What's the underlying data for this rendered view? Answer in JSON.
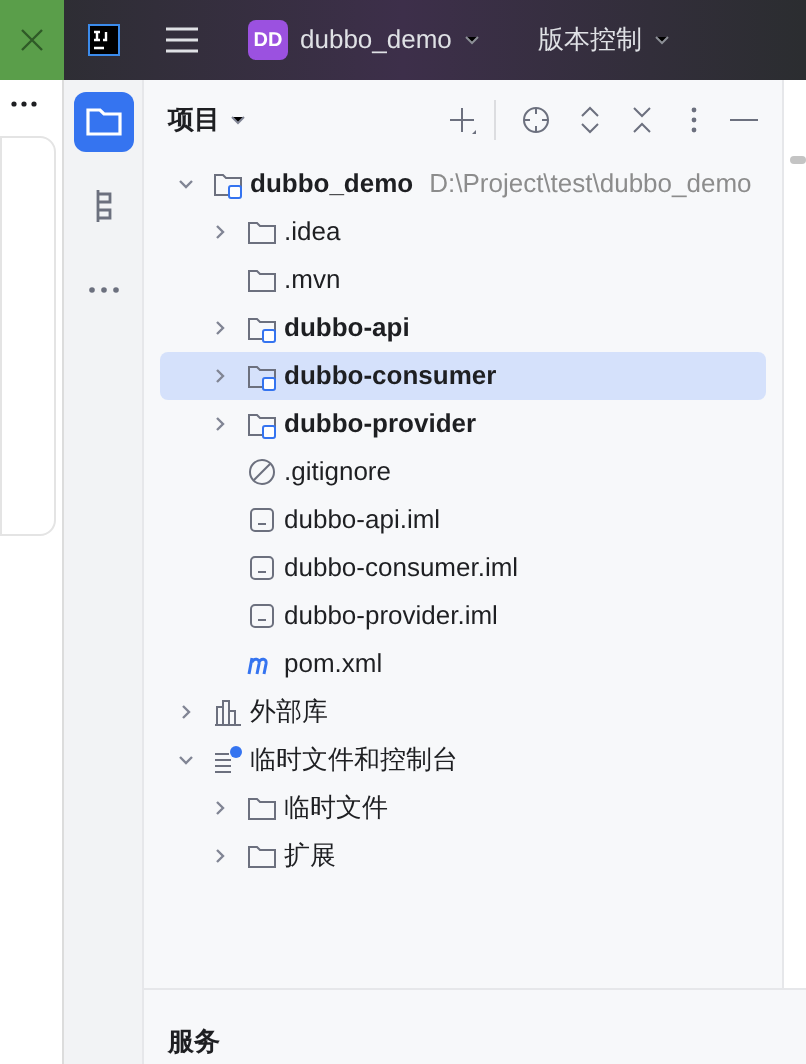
{
  "titlebar": {
    "project_badge": "DD",
    "project_name": "dubbo_demo",
    "vcs_menu": "版本控制"
  },
  "sidebar_tools": [
    {
      "kind": "project",
      "selected": true
    },
    {
      "kind": "structure",
      "selected": false
    },
    {
      "kind": "more",
      "selected": false
    }
  ],
  "panel": {
    "title": "项目"
  },
  "tree": [
    {
      "label": "dubbo_demo",
      "hint": "D:\\Project\\test\\dubbo_demo",
      "kind": "module",
      "bold": true,
      "expanded": true,
      "selected": false,
      "children": [
        {
          "label": ".idea",
          "kind": "folder",
          "bold": false,
          "expanded": false,
          "selected": false
        },
        {
          "label": ".mvn",
          "kind": "folder",
          "bold": false,
          "selected": false
        },
        {
          "label": "dubbo-api",
          "kind": "module",
          "bold": true,
          "expanded": false,
          "selected": false
        },
        {
          "label": "dubbo-consumer",
          "kind": "module",
          "bold": true,
          "expanded": false,
          "selected": true
        },
        {
          "label": "dubbo-provider",
          "kind": "module",
          "bold": true,
          "expanded": false,
          "selected": false
        },
        {
          "label": ".gitignore",
          "kind": "ignore",
          "bold": false,
          "selected": false
        },
        {
          "label": "dubbo-api.iml",
          "kind": "file",
          "bold": false,
          "selected": false
        },
        {
          "label": "dubbo-consumer.iml",
          "kind": "file",
          "bold": false,
          "selected": false
        },
        {
          "label": "dubbo-provider.iml",
          "kind": "file",
          "bold": false,
          "selected": false
        },
        {
          "label": "pom.xml",
          "kind": "maven",
          "bold": false,
          "selected": false
        }
      ]
    },
    {
      "label": "外部库",
      "kind": "library",
      "bold": false,
      "expanded": false,
      "selected": false
    },
    {
      "label": "临时文件和控制台",
      "kind": "scratch",
      "bold": false,
      "expanded": true,
      "selected": false,
      "children": [
        {
          "label": "临时文件",
          "kind": "folder",
          "bold": false,
          "expanded": false,
          "selected": false
        },
        {
          "label": "扩展",
          "kind": "folder",
          "bold": false,
          "expanded": false,
          "selected": false
        }
      ]
    }
  ],
  "bottom_panel": {
    "title": "服务"
  }
}
